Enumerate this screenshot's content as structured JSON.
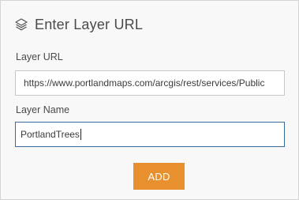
{
  "header": {
    "icon": "layers-icon",
    "title": "Enter Layer URL"
  },
  "form": {
    "url_label": "Layer URL",
    "url_value": "https://www.portlandmaps.com/arcgis/rest/services/Public",
    "name_label": "Layer Name",
    "name_value": "PortlandTrees"
  },
  "actions": {
    "add_label": "ADD"
  },
  "colors": {
    "accent": "#e8902e",
    "focus_border": "#3a6b9e",
    "panel_bg": "#f8f8f8"
  }
}
